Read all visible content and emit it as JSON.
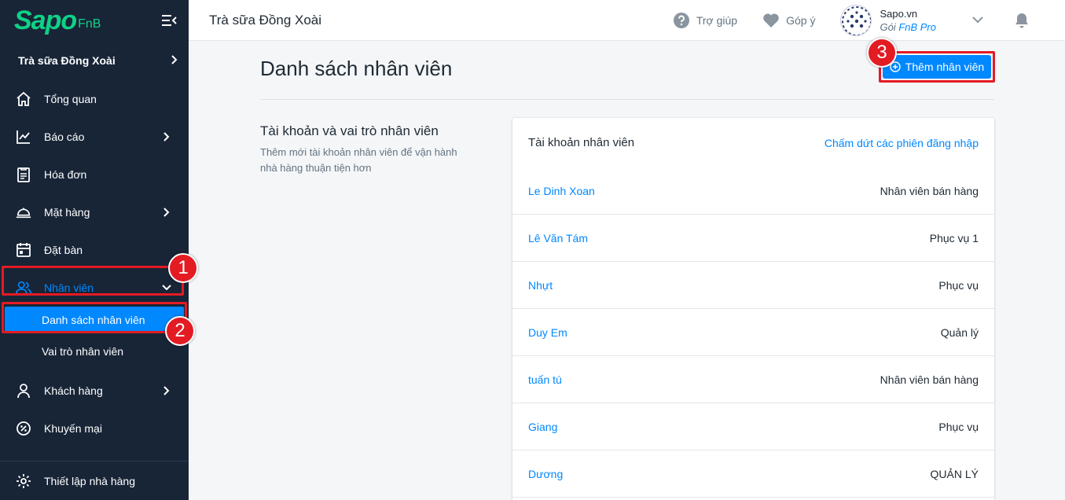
{
  "brand": {
    "logo_main": "Sapo",
    "logo_sub": "FnB"
  },
  "sidebar": {
    "store_name": "Trà sữa Đồng Xoài",
    "items": [
      {
        "label": "Tổng quan"
      },
      {
        "label": "Báo cáo"
      },
      {
        "label": "Hóa đơn"
      },
      {
        "label": "Mặt hàng"
      },
      {
        "label": "Đặt bàn"
      },
      {
        "label": "Nhân viên"
      },
      {
        "label": "Khách hàng"
      },
      {
        "label": "Khuyến mại"
      }
    ],
    "sub_items": [
      {
        "label": "Danh sách nhân viên"
      },
      {
        "label": "Vai trò nhân viên"
      }
    ],
    "footer": "Thiết lập nhà hàng"
  },
  "header": {
    "title": "Trà sữa Đồng Xoài",
    "help": "Trợ giúp",
    "feedback": "Góp ý",
    "account_name": "Sapo.vn",
    "plan_prefix": "Gói",
    "plan_name": "FnB Pro"
  },
  "main": {
    "page_title": "Danh sách nhân viên",
    "add_button": "Thêm nhân viên",
    "section_title": "Tài khoản và vai trò nhân viên",
    "section_desc": "Thêm mới tài khoản nhân viên để vận hành nhà hàng thuận tiện hơn",
    "card_title": "Tài khoản nhân viên",
    "end_sessions": "Chấm dứt các phiên đăng nhập",
    "staff": [
      {
        "name": "Le Dinh Xoan",
        "role": "Nhân viên bán hàng"
      },
      {
        "name": "Lê Văn Tám",
        "role": "Phục vụ 1"
      },
      {
        "name": "Nhựt",
        "role": "Phục vụ"
      },
      {
        "name": "Duy Em",
        "role": "Quản lý"
      },
      {
        "name": "tuấn tú",
        "role": "Nhân viên bán hàng"
      },
      {
        "name": "Giang",
        "role": "Phục vụ"
      },
      {
        "name": "Dương",
        "role": "QUẢN LÝ"
      }
    ]
  },
  "annotations": {
    "step1": "1",
    "step2": "2",
    "step3": "3"
  },
  "colors": {
    "accent": "#0088ff",
    "sidebar_bg": "#182537",
    "highlight": "#e31b23",
    "logo": "#0fd186"
  }
}
